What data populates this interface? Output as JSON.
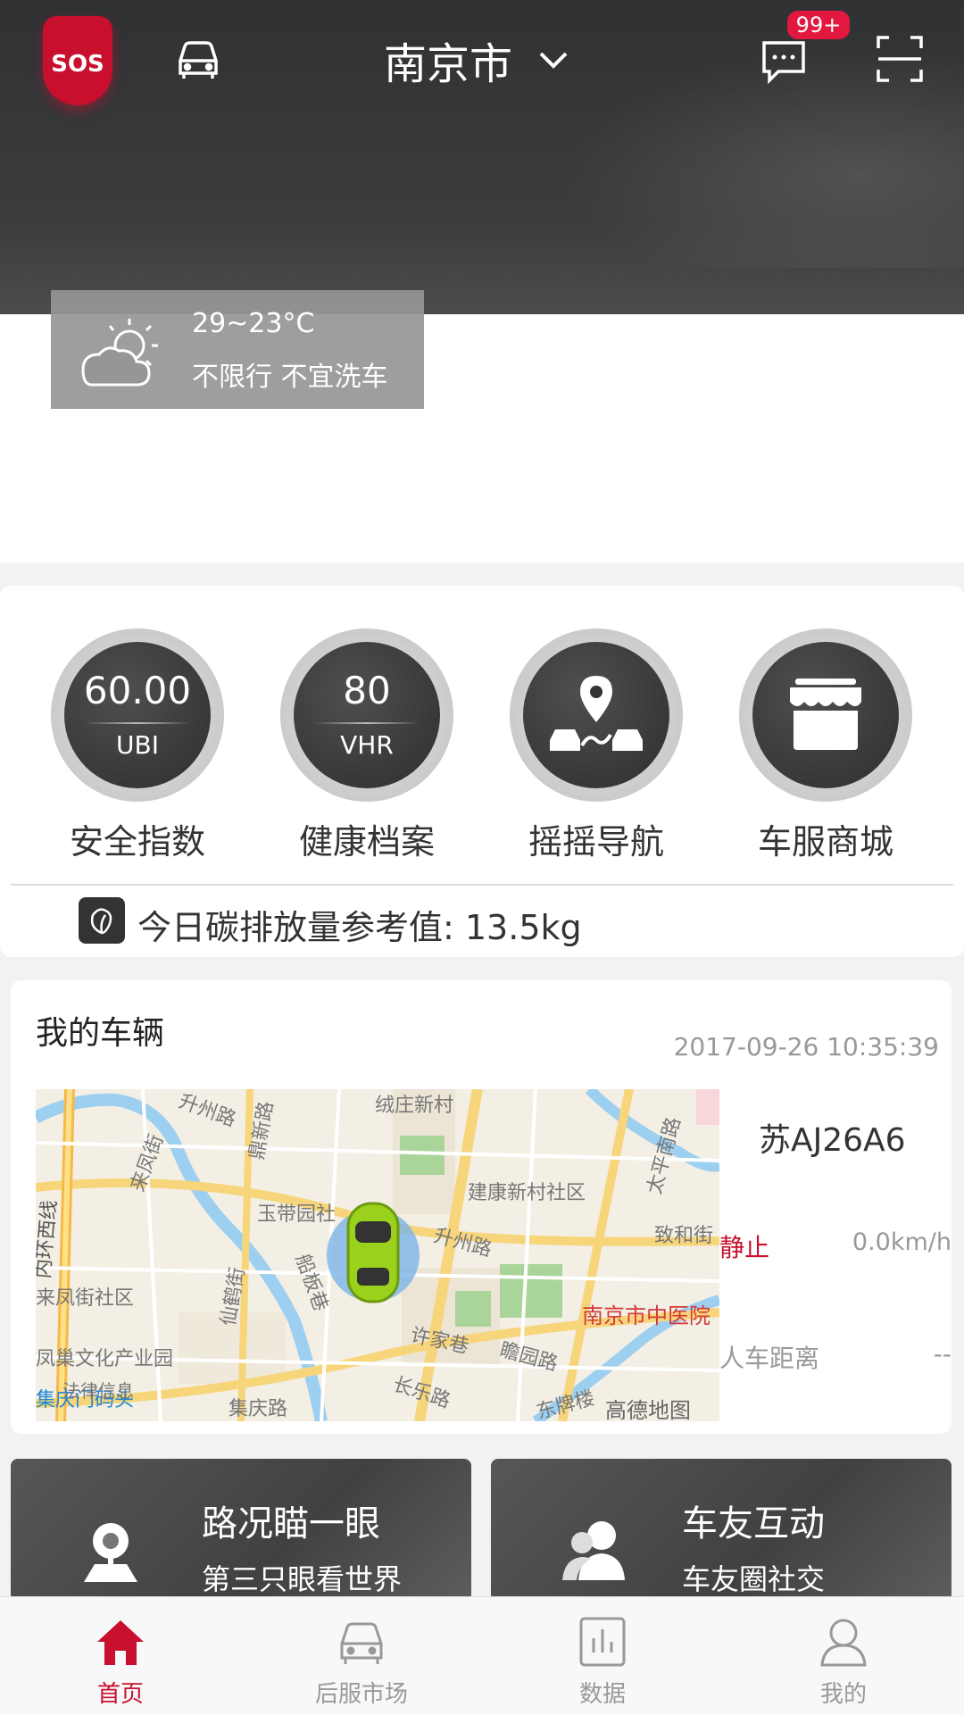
{
  "header": {
    "sos_label": "SOS",
    "city": "南京市",
    "message_badge": "99+"
  },
  "weather": {
    "temperature": "29~23°C",
    "restriction": "不限行  不宜洗车"
  },
  "features": [
    {
      "value": "60.00",
      "unit": "UBI",
      "label": "安全指数",
      "icon": "ubi-score"
    },
    {
      "value": "80",
      "unit": "VHR",
      "label": "健康档案",
      "icon": "vhr-score"
    },
    {
      "value": "",
      "unit": "",
      "label": "摇摇导航",
      "icon": "navigation-icon"
    },
    {
      "value": "",
      "unit": "",
      "label": "车服商城",
      "icon": "store-icon"
    }
  ],
  "carbon": {
    "text": "今日碳排放量参考值: 13.5kg"
  },
  "vehicle": {
    "title": "我的车辆",
    "timestamp": "2017-09-26 10:35:39",
    "plate": "苏AJ26A6",
    "status": "静止",
    "speed": "0.0km/h",
    "distance_label": "人车距离",
    "distance_value": "--",
    "map_labels": {
      "l1": "绒庄新村",
      "l2": "升州路",
      "l3": "鼎新路",
      "l4": "来凤街",
      "l5": "建康新村社区",
      "l6": "太平南路",
      "l7": "玉带园社",
      "l8": "升州路",
      "l9": "致和街",
      "l10": "内环西线",
      "l11": "来凤街社区",
      "l12": "仙鹤街",
      "l13": "船板巷",
      "l14": "南京市中医院",
      "l15": "许家巷",
      "l16": "瞻园路",
      "l17": "凤巢文化产业园",
      "l18": "长乐路",
      "l19": "集庆门码头",
      "l20": "集庆路",
      "l21": "东牌楼",
      "l22": "高德地图",
      "l23": "法律信息"
    }
  },
  "promos": [
    {
      "title": "路况瞄一眼",
      "subtitle": "第三只眼看世界"
    },
    {
      "title": "车友互动",
      "subtitle": "车友圈社交"
    }
  ],
  "tabs": [
    {
      "label": "首页",
      "active": true
    },
    {
      "label": "后服市场",
      "active": false
    },
    {
      "label": "数据",
      "active": false
    },
    {
      "label": "我的",
      "active": false
    }
  ],
  "colors": {
    "accent": "#c8102e",
    "header_bg": "#343638",
    "tab_inactive": "#999999"
  }
}
